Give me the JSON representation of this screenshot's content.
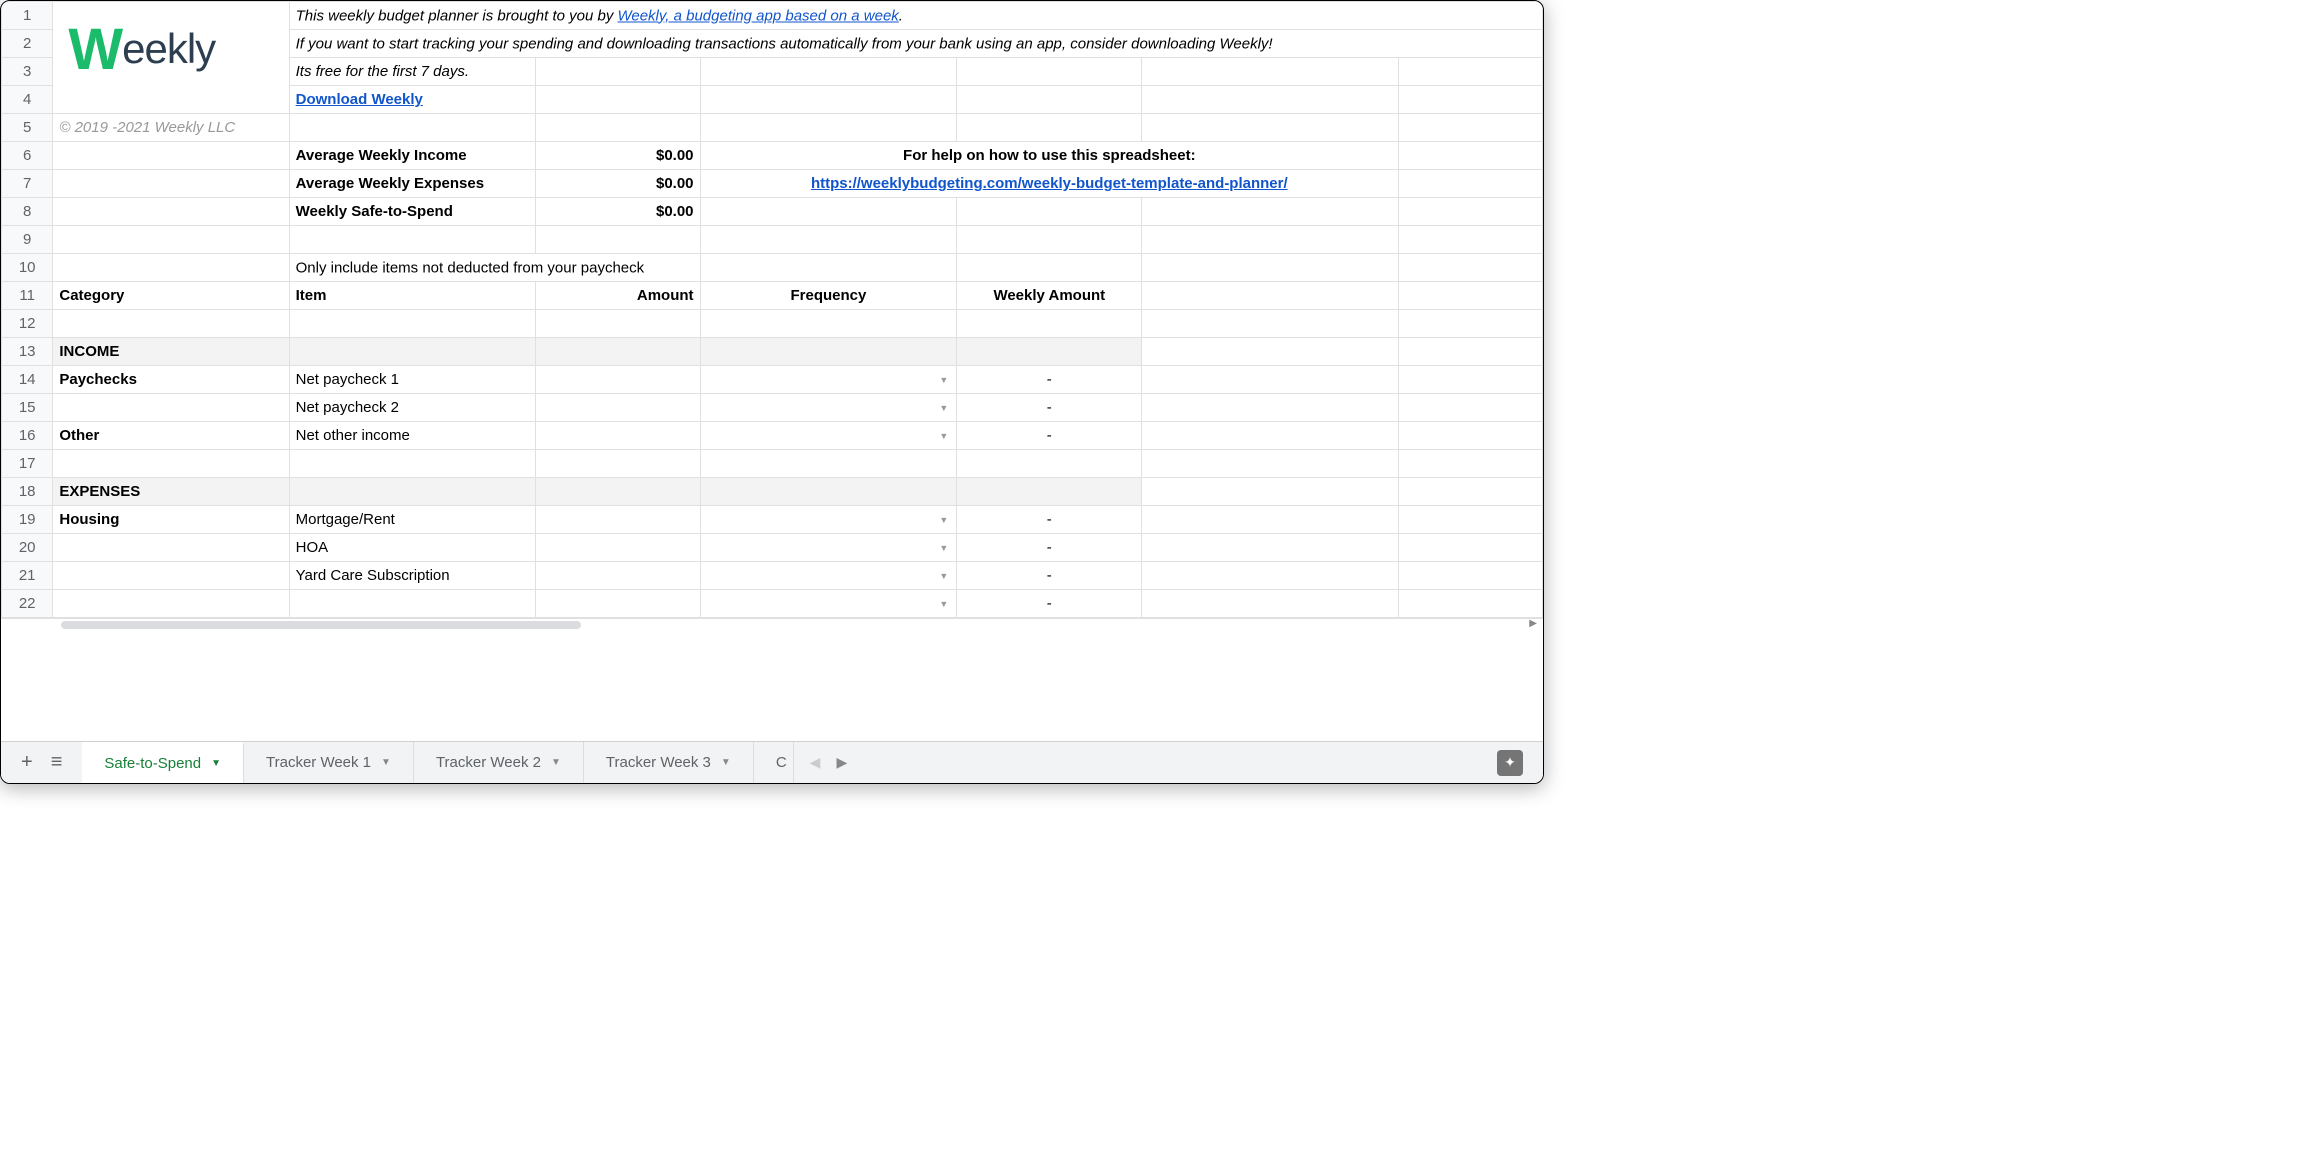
{
  "intro": {
    "line1_prefix": "This weekly budget planner is brought to you by ",
    "line1_link": "Weekly, a budgeting app based on a week",
    "line1_suffix": ".",
    "line2": "If you want to start tracking your spending and downloading transactions automatically from your bank using an app, consider downloading Weekly!",
    "line3": "Its free for the first 7 days.",
    "download_link": "Download Weekly",
    "copyright": "© 2019 -2021 Weekly LLC"
  },
  "summary": {
    "avg_income_label": "Average Weekly Income",
    "avg_income_value": "$0.00",
    "avg_expenses_label": "Average Weekly Expenses",
    "avg_expenses_value": "$0.00",
    "safe_label": "Weekly Safe-to-Spend",
    "safe_value": "$0.00",
    "help_label": "For help on how to use this spreadsheet:",
    "help_link": "https://weeklybudgeting.com/weekly-budget-template-and-planner/",
    "note": "Only include items not deducted from your paycheck"
  },
  "headers": {
    "category": "Category",
    "item": "Item",
    "amount": "Amount",
    "frequency": "Frequency",
    "weekly_amount": "Weekly Amount"
  },
  "sections": {
    "income": "INCOME",
    "expenses": "EXPENSES"
  },
  "rows": {
    "paychecks_label": "Paychecks",
    "paycheck1": "Net paycheck 1",
    "paycheck2": "Net paycheck 2",
    "other_label": "Other",
    "other_income": "Net other income",
    "housing_label": "Housing",
    "mortgage": "Mortgage/Rent",
    "hoa": "HOA",
    "yard": "Yard Care Subscription",
    "dash": "-"
  },
  "tabs": {
    "active": "Safe-to-Spend",
    "t2": "Tracker Week 1",
    "t3": "Tracker Week 2",
    "t4": "Tracker Week 3",
    "t5": "C"
  },
  "row_numbers": [
    "1",
    "2",
    "3",
    "4",
    "5",
    "6",
    "7",
    "8",
    "9",
    "10",
    "11",
    "12",
    "13",
    "14",
    "15",
    "16",
    "17",
    "18",
    "19",
    "20",
    "21",
    "22"
  ]
}
